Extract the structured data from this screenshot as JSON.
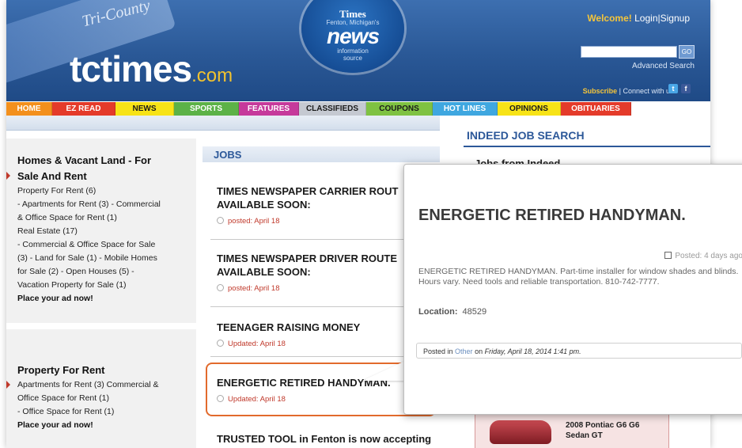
{
  "header": {
    "tricounty": "Tri-County",
    "logo_main": "tctimes",
    "logo_suffix": ".com",
    "globe": {
      "times": "Times",
      "fenton": "Fenton, Michigan's",
      "news": "news",
      "info1": "information",
      "info2": "source"
    },
    "welcome": "Welcome!",
    "login": "Login",
    "signup": "Signup",
    "go": "GO",
    "advanced_search": "Advanced Search",
    "subscribe": "Subscribe",
    "connect": "Connect with us:"
  },
  "nav": [
    {
      "label": "HOME",
      "color": "#f3901d",
      "text": "#ffffff"
    },
    {
      "label": "EZ READ",
      "color": "#e43b2a",
      "text": "#ffffff"
    },
    {
      "label": "NEWS",
      "color": "#f7e317",
      "text": "#1a1a1a"
    },
    {
      "label": "SPORTS",
      "color": "#5cb247",
      "text": "#ffffff"
    },
    {
      "label": "FEATURES",
      "color": "#c63a9b",
      "text": "#ffffff"
    },
    {
      "label": "CLASSIFIEDS",
      "color": "#c5c9d1",
      "text": "#1a1a1a"
    },
    {
      "label": "COUPONS",
      "color": "#7fc242",
      "text": "#1a1a1a"
    },
    {
      "label": "HOT LINES",
      "color": "#3fa7e0",
      "text": "#ffffff"
    },
    {
      "label": "OPINIONS",
      "color": "#f7e317",
      "text": "#1a1a1a"
    },
    {
      "label": "OBITUARIES",
      "color": "#e43b2a",
      "text": "#ffffff"
    }
  ],
  "left": {
    "box1": {
      "heading1": "Homes & Vacant Land - For",
      "heading2": "Sale And Rent",
      "lines": [
        "Property For Rent (6)",
        "- Apartments for Rent (3) - Commercial",
        "& Office Space for Rent (1)",
        "Real Estate (17)",
        "- Commercial & Office Space for Sale",
        "(3) - Land for Sale (1) - Mobile Homes",
        "for Sale (2) - Open Houses (5) -",
        "Vacation Property for Sale (1)"
      ],
      "cta": "Place your ad now!"
    },
    "box2": {
      "heading": "Property For Rent",
      "lines": [
        "Apartments for Rent (3) Commercial &",
        "Office Space for Rent (1)",
        "- Office Space for Rent (1)"
      ],
      "cta": "Place your ad now!"
    }
  },
  "jobs": {
    "heading": "JOBS",
    "items": [
      {
        "title1": "TIMES NEWSPAPER CARRIER ROUT",
        "title2": "AVAILABLE SOON:",
        "date": "posted: April 18"
      },
      {
        "title1": "TIMES NEWSPAPER DRIVER ROUTE",
        "title2": "AVAILABLE SOON:",
        "date": "posted: April 18"
      },
      {
        "title1": "TEENAGER RAISING MONEY",
        "title2": "",
        "date": "Updated: April 18"
      },
      {
        "title1": "ENERGETIC RETIRED HANDYMAN.",
        "title2": "",
        "date": "Updated: April 18"
      },
      {
        "title1": "TRUSTED TOOL in Fenton is now accepting",
        "title2": "",
        "date": ""
      }
    ]
  },
  "right": {
    "indeed": "INDEED JOB SEARCH",
    "jobs_from": "Jobs from Indeed",
    "ad_line1": "2008 Pontiac G6 G6",
    "ad_line2": "Sedan GT"
  },
  "popup": {
    "title": "ENERGETIC RETIRED HANDYMAN.",
    "posted": "Posted: 4 days ago",
    "description": "ENERGETIC RETIRED HANDYMAN. Part-time installer for window shades and blinds. Hours vary. Need tools and reliable transportation. 810-742-7777.",
    "location_label": "Location:",
    "location_value": "48529",
    "meta_prefix": "Posted in",
    "meta_category": "Other",
    "meta_on": "on",
    "meta_date": "Friday, April 18, 2014 1:41 pm."
  }
}
